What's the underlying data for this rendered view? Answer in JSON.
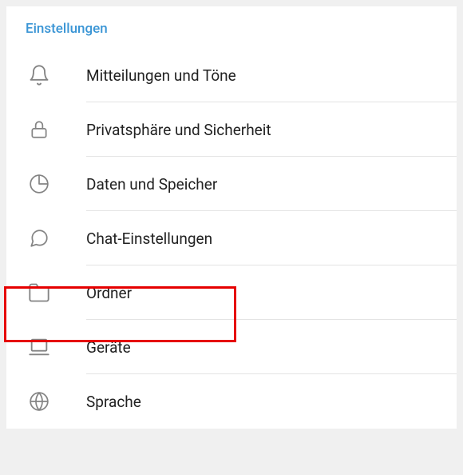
{
  "section": {
    "title": "Einstellungen"
  },
  "items": [
    {
      "label": "Mitteilungen und Töne",
      "icon": "bell-icon"
    },
    {
      "label": "Privatsphäre und Sicherheit",
      "icon": "lock-icon"
    },
    {
      "label": "Daten und Speicher",
      "icon": "pie-icon"
    },
    {
      "label": "Chat-Einstellungen",
      "icon": "chat-icon"
    },
    {
      "label": "Ordner",
      "icon": "folder-icon"
    },
    {
      "label": "Geräte",
      "icon": "laptop-icon"
    },
    {
      "label": "Sprache",
      "icon": "globe-icon"
    }
  ],
  "highlighted_index": 4
}
